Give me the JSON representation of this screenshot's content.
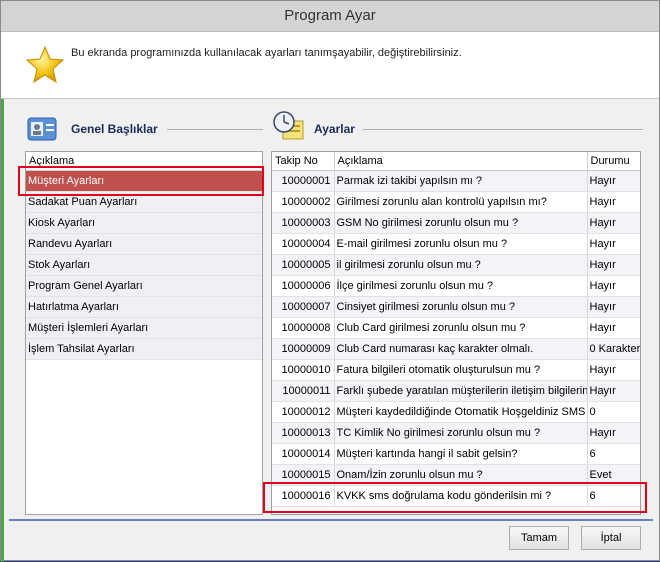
{
  "window": {
    "title": "Program Ayar"
  },
  "header": {
    "description": "Bu ekranda programınızda kullanılacak ayarları tanımşayabilir, değiştirebilirsiniz.",
    "icon": "star-icon"
  },
  "left_section": {
    "title": "Genel Başlıklar",
    "column_header": "Açıklama",
    "items": [
      "Müşteri Ayarları",
      "Sadakat Puan Ayarları",
      "Kiosk Ayarları",
      "Randevu Ayarları",
      "Stok Ayarları",
      "Program Genel Ayarları",
      "Hatırlatma Ayarları",
      "Müşteri İşlemleri Ayarları",
      "İşlem Tahsilat Ayarları"
    ],
    "selected_index": 0
  },
  "right_section": {
    "title": "Ayarlar",
    "columns": [
      "Takip No",
      "Açıklama",
      "Durumu"
    ],
    "rows": [
      [
        "10000001",
        "Parmak izi takibi yapılsın mı ?",
        "Hayır"
      ],
      [
        "10000002",
        "Girilmesi zorunlu alan kontrolü yapılsın mı?",
        "Hayır"
      ],
      [
        "10000003",
        "GSM No girilmesi zorunlu olsun mu ?",
        "Hayır"
      ],
      [
        "10000004",
        "E-mail girilmesi zorunlu olsun mu ?",
        "Hayır"
      ],
      [
        "10000005",
        "il girilmesi zorunlu olsun mu ?",
        "Hayır"
      ],
      [
        "10000006",
        "İlçe girilmesi zorunlu olsun mu ?",
        "Hayır"
      ],
      [
        "10000007",
        "Cinsiyet girilmesi zorunlu olsun mu ?",
        "Hayır"
      ],
      [
        "10000008",
        "Club Card girilmesi zorunlu olsun mu ?",
        "Hayır"
      ],
      [
        "10000009",
        "Club Card numarası kaç karakter olmalı.",
        "0 Karakter"
      ],
      [
        "10000010",
        "Fatura bilgileri otomatik oluşturulsun mu ?",
        "Hayır"
      ],
      [
        "10000011",
        "Farklı şubede yaratılan müşterilerin iletişim bilgilerini gi",
        "Hayır"
      ],
      [
        "10000012",
        "Müşteri kaydedildiğinde Otomatik Hoşgeldiniz SMS i gö",
        "0"
      ],
      [
        "10000013",
        "TC Kimlik No girilmesi zorunlu olsun mu ?",
        "Hayır"
      ],
      [
        "10000014",
        "Müşteri kartında hangi il sabit gelsin?",
        "6"
      ],
      [
        "10000015",
        "Onam/İzin zorunlu olsun mu ?",
        "Evet"
      ],
      [
        "10000016",
        "KVKK sms doğrulama kodu gönderilsin mi ?",
        "6"
      ]
    ]
  },
  "footer": {
    "ok_label": "Tamam",
    "cancel_label": "İptal"
  }
}
